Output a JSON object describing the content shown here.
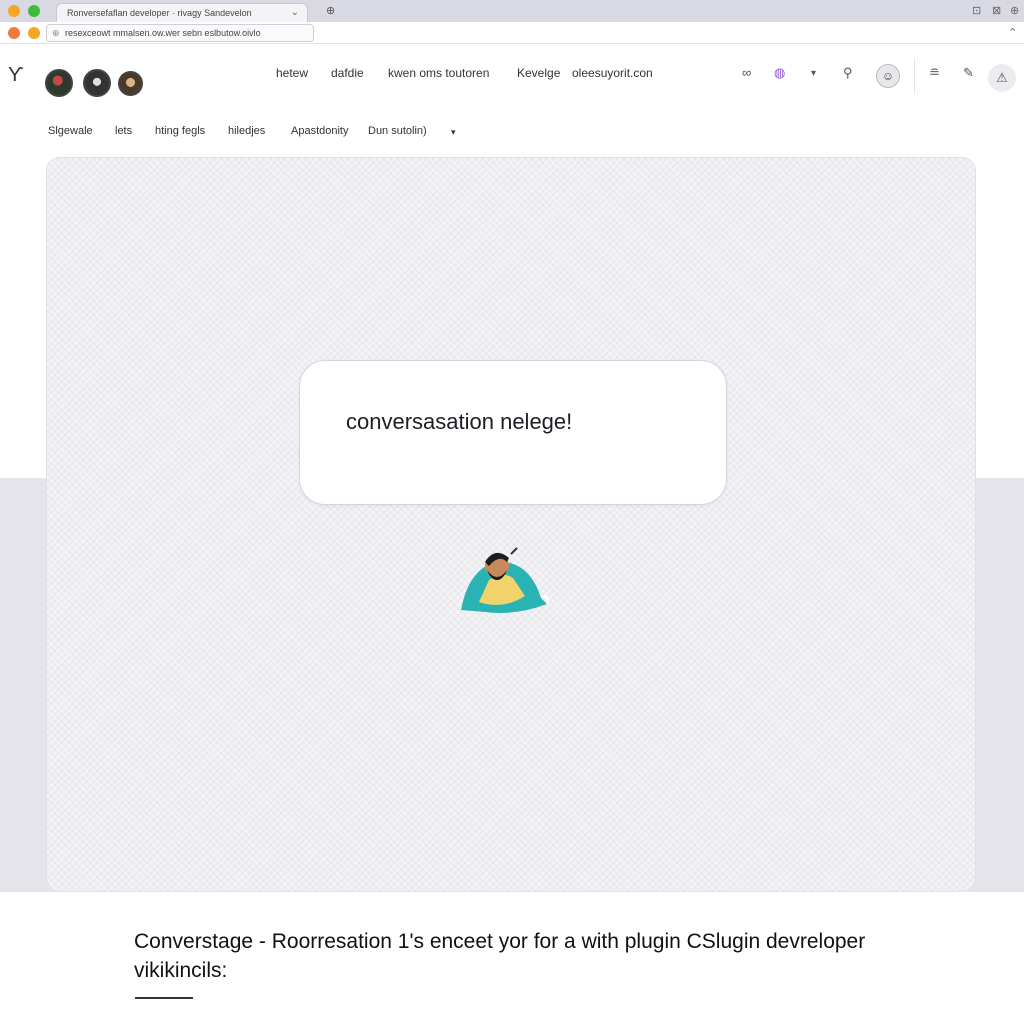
{
  "browser": {
    "tab_title": "Ronversefaflan developer · rivagy Sandevelon",
    "tab_close_icon": "close-icon",
    "address": "resexceowt mmalsen.ow.wer sebn eslbutow.oivlo",
    "colors": {
      "close": "#f5a623",
      "minimize": "#f5a623",
      "maximize": "#3dbb3d"
    }
  },
  "header": {
    "logo_glyph": "ϒ",
    "nav": [
      "hetew",
      "dafdie",
      "kwen oms toutoren",
      "Kevelge",
      "oleesuyorit.con"
    ],
    "icons": [
      "link-icon",
      "globe-icon",
      "chevron-down-icon",
      "pin-icon",
      "profile-icon",
      "stack-icon",
      "edit-icon",
      "alert-icon"
    ]
  },
  "subnav": {
    "items": [
      "Slgewale",
      "lets",
      "hting fegls",
      "hiledjes",
      "Apastdonity",
      "Dun sutolin)"
    ],
    "dropdown_glyph": "▾"
  },
  "main": {
    "bubble_text": "conversasation nelege!"
  },
  "footer": {
    "caption": "Converstage - Roorresation 1's enceet yor for a with plugin CSlugin devreloper vikikincils:"
  }
}
